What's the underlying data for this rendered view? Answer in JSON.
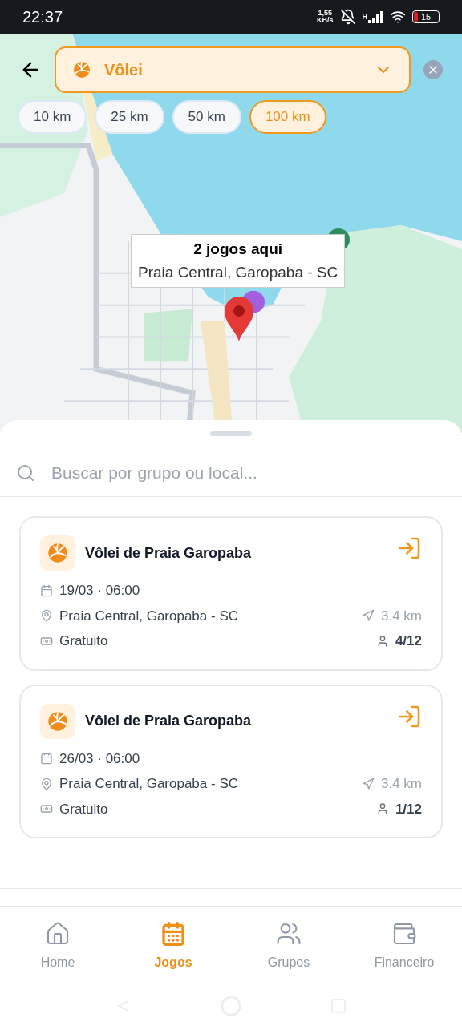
{
  "status_bar": {
    "time": "22:37",
    "speed": "1,55\nKB/s",
    "network": "H",
    "battery": "15"
  },
  "filter": {
    "sport": "Vôlei"
  },
  "radius_chips": [
    {
      "label": "10 km",
      "selected": false
    },
    {
      "label": "25 km",
      "selected": false
    },
    {
      "label": "50 km",
      "selected": false
    },
    {
      "label": "100 km",
      "selected": true
    }
  ],
  "map": {
    "callout": {
      "title": "2 jogos aqui",
      "subtitle": "Praia Central, Garopaba - SC"
    }
  },
  "search": {
    "placeholder": "Buscar por grupo ou local..."
  },
  "games": [
    {
      "title": "Vôlei de Praia Garopaba",
      "date": "19/03 · 06:00",
      "location": "Praia Central, Garopaba - SC",
      "distance": "3.4 km",
      "price": "Gratuito",
      "players": "4/12"
    },
    {
      "title": "Vôlei de Praia Garopaba",
      "date": "26/03 · 06:00",
      "location": "Praia Central, Garopaba - SC",
      "distance": "3.4 km",
      "price": "Gratuito",
      "players": "1/12"
    }
  ],
  "bottom_nav": [
    {
      "label": "Home",
      "selected": false
    },
    {
      "label": "Jogos",
      "selected": true
    },
    {
      "label": "Grupos",
      "selected": false
    },
    {
      "label": "Financeiro",
      "selected": false
    }
  ]
}
